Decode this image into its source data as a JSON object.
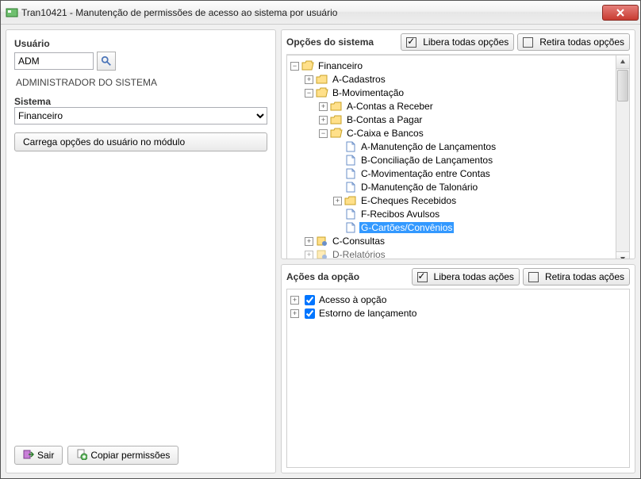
{
  "window": {
    "title": "Tran10421 - Manutenção de permissões de acesso ao sistema por usuário"
  },
  "left": {
    "user_label": "Usuário",
    "user_value": "ADM",
    "user_name": "ADMINISTRADOR DO SISTEMA",
    "system_label": "Sistema",
    "system_value": "Financeiro",
    "load_button": "Carrega opções do usuário no módulo",
    "exit_button": "Sair",
    "copy_button": "Copiar permissões"
  },
  "options": {
    "group_title": "Opções do sistema",
    "liberate_all": "Libera todas opções",
    "remove_all": "Retira todas opções",
    "tree": {
      "root": "Financeiro",
      "a": "A-Cadastros",
      "b": "B-Movimentação",
      "b_a": "A-Contas a Receber",
      "b_b": "B-Contas a Pagar",
      "b_c": "C-Caixa e Bancos",
      "b_c_a": "A-Manutenção de Lançamentos",
      "b_c_b": "B-Conciliação de Lançamentos",
      "b_c_c": "C-Movimentação entre Contas",
      "b_c_d": "D-Manutenção de Talonário",
      "b_c_e": "E-Cheques Recebidos",
      "b_c_f": "F-Recibos Avulsos",
      "b_c_g": "G-Cartões/Convênios",
      "c": "C-Consultas",
      "d": "D-Relatórios"
    }
  },
  "actions": {
    "group_title": "Ações da opção",
    "liberate_all": "Libera todas ações",
    "remove_all": "Retira todas ações",
    "items": {
      "a": "Acesso à opção",
      "b": "Estorno de lançamento"
    }
  }
}
